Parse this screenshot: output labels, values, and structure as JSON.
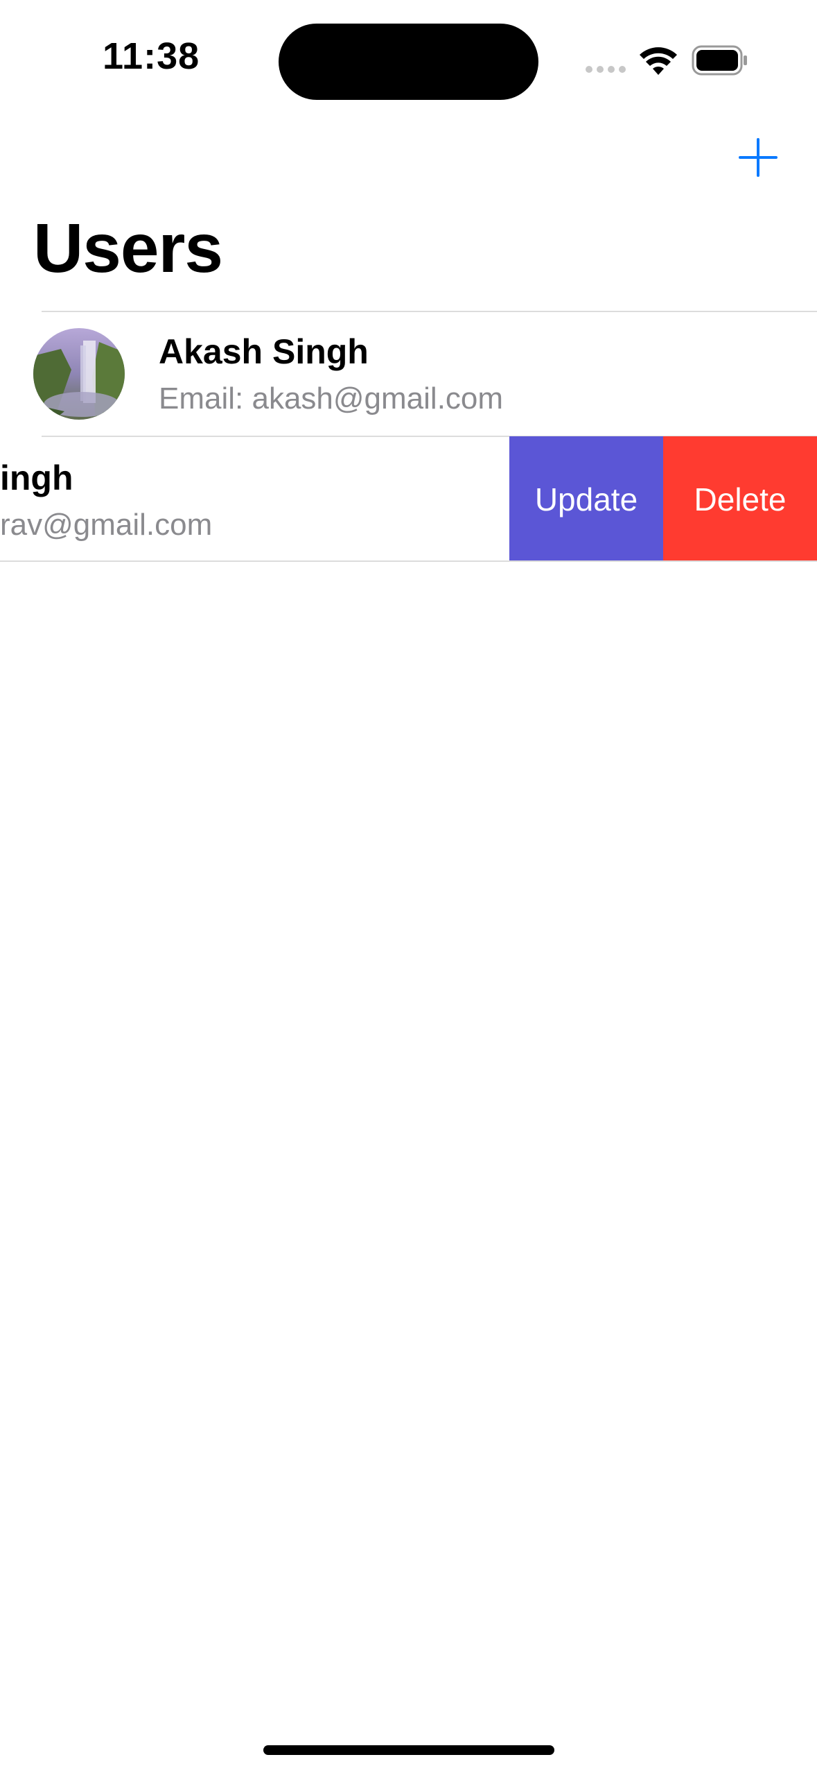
{
  "status_bar": {
    "time": "11:38"
  },
  "nav": {
    "add_icon": "plus-icon",
    "title": "Users"
  },
  "users": [
    {
      "name": "Akash Singh",
      "email": "Email: akash@gmail.com",
      "avatar": "waterfall-photo"
    },
    {
      "name_visible": "ingh",
      "email_visible": "rav@gmail.com"
    }
  ],
  "swipe_actions": {
    "update_label": "Update",
    "delete_label": "Delete"
  },
  "colors": {
    "accent": "#0a7aff",
    "update": "#5b56d6",
    "delete": "#ff3b30",
    "secondary_text": "#8a8a8e"
  }
}
